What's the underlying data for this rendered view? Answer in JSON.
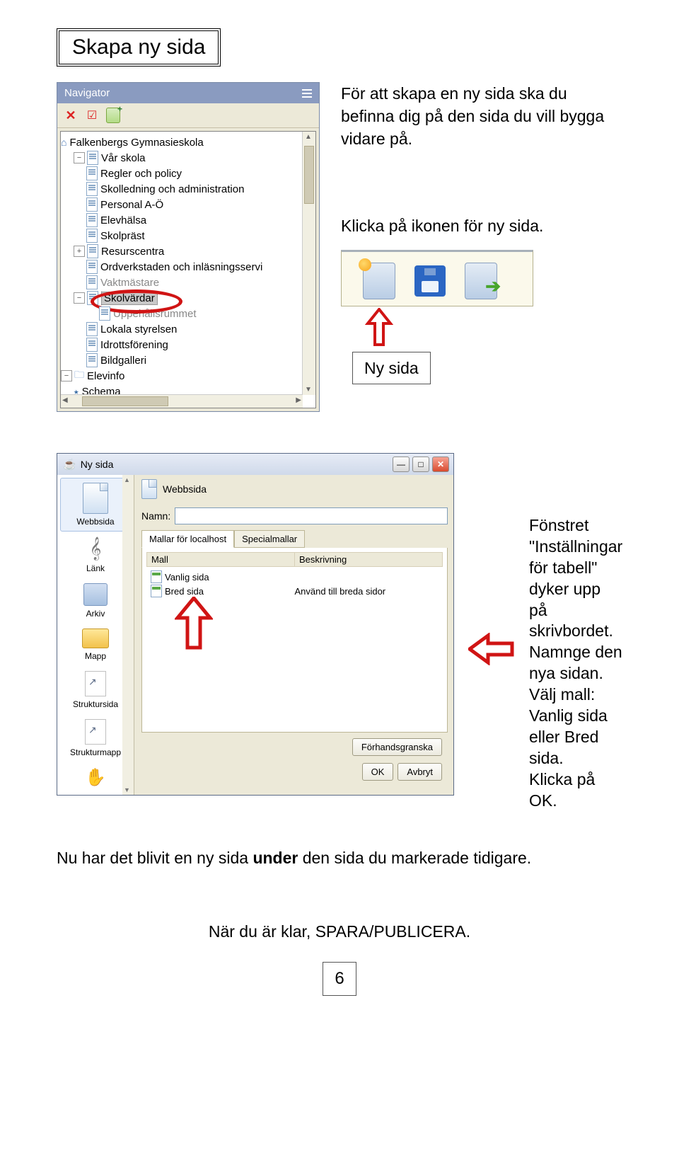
{
  "title": "Skapa ny sida",
  "instructions": {
    "intro": "För att skapa en ny sida ska du befinna dig på den sida du vill bygga vidare på.",
    "click_icon": "Klicka på ikonen för ny sida.",
    "ny_sida_label": "Ny sida",
    "fonstret_1": "Fönstret \"Inställningar för tabell\" dyker upp på skrivbordet.",
    "fonstret_2": "Namnge den nya sidan.",
    "fonstret_3": "Välj mall:",
    "fonstret_4": "Vanlig sida eller Bred sida.",
    "fonstret_5": "Klicka på OK.",
    "bottom_1_a": "Nu har det blivit en ny sida ",
    "bottom_1_b": "under",
    "bottom_1_c": " den sida du markerade tidigare.",
    "bottom_2": "När du är klar, SPARA/PUBLICERA."
  },
  "navigator": {
    "title": "Navigator",
    "root": "Falkenbergs Gymnasieskola",
    "items": [
      "Vår skola",
      "Regler och policy",
      "Skolledning och administration",
      "Personal A-Ö",
      "Elevhälsa",
      "Skolpräst",
      "Resurscentra",
      "Ordverkstaden och inläsningsservi",
      "Vaktmästare",
      "Skolvärdar",
      "Uppehållsrummet",
      "Lokala styrelsen",
      "Idrottsförening",
      "Bildgalleri"
    ],
    "elevinfo": "Elevinfo",
    "schema": "Schema"
  },
  "dialog": {
    "title": "Ny sida",
    "sidebar": [
      "Webbsida",
      "Länk",
      "Arkiv",
      "Mapp",
      "Struktursida",
      "Strukturmapp"
    ],
    "main_head": "Webbsida",
    "namn_label": "Namn:",
    "tabs": [
      "Mallar för localhost",
      "Specialmallar"
    ],
    "col_mall": "Mall",
    "col_besk": "Beskrivning",
    "rows": [
      {
        "name": "Vanlig sida",
        "desc": ""
      },
      {
        "name": "Bred sida",
        "desc": "Använd till breda sidor"
      }
    ],
    "buttons": {
      "preview": "Förhandsgranska",
      "ok": "OK",
      "cancel": "Avbryt"
    }
  },
  "page_number": "6"
}
